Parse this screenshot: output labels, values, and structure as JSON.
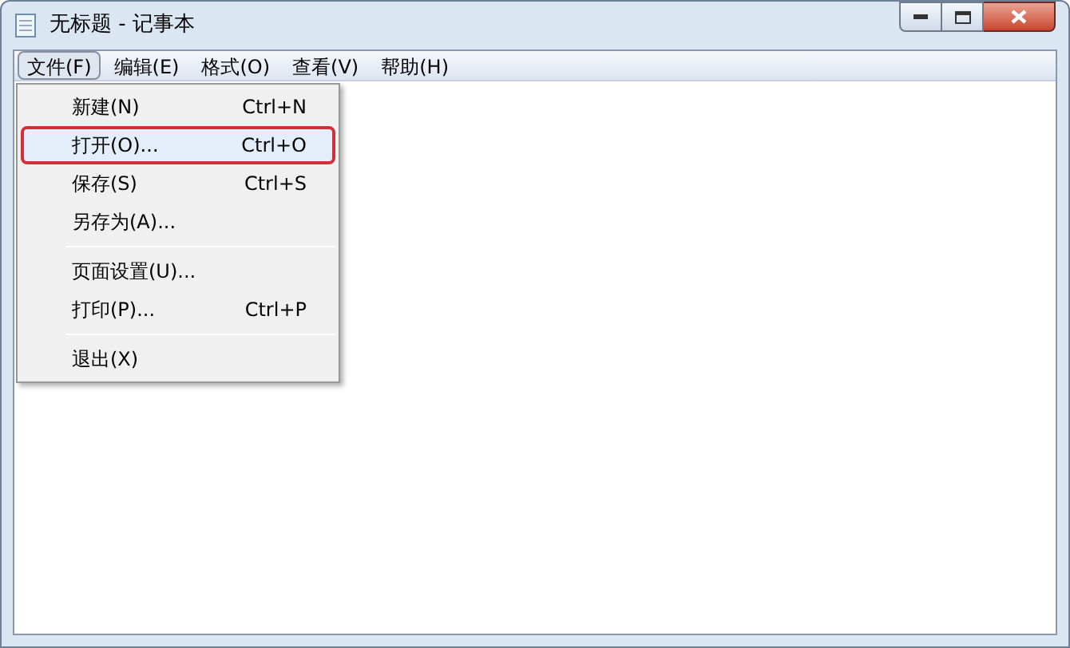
{
  "window": {
    "title": "无标题 - 记事本"
  },
  "menu_bar": [
    {
      "label": "文件(F)",
      "selected": true
    },
    {
      "label": "编辑(E)",
      "selected": false
    },
    {
      "label": "格式(O)",
      "selected": false
    },
    {
      "label": "查看(V)",
      "selected": false
    },
    {
      "label": "帮助(H)",
      "selected": false
    }
  ],
  "file_menu": [
    {
      "kind": "item",
      "label": "新建(N)",
      "shortcut": "Ctrl+N",
      "selected": false
    },
    {
      "kind": "item",
      "label": "打开(O)...",
      "shortcut": "Ctrl+O",
      "selected": true
    },
    {
      "kind": "item",
      "label": "保存(S)",
      "shortcut": "Ctrl+S",
      "selected": false
    },
    {
      "kind": "item",
      "label": "另存为(A)...",
      "selected": false
    },
    {
      "kind": "separator"
    },
    {
      "kind": "item",
      "label": "页面设置(U)...",
      "selected": false
    },
    {
      "kind": "item",
      "label": "打印(P)...",
      "shortcut": "Ctrl+P",
      "selected": false
    },
    {
      "kind": "separator"
    },
    {
      "kind": "item",
      "label": "退出(X)",
      "selected": false
    }
  ]
}
